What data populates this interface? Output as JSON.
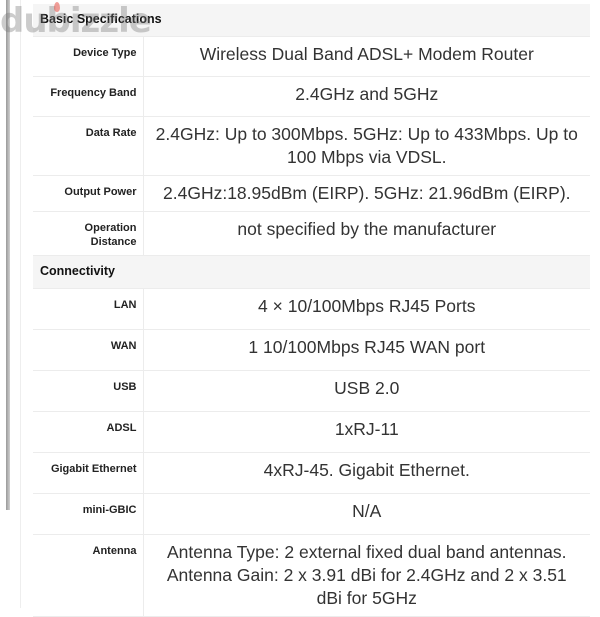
{
  "watermark": {
    "text": "dubizzle"
  },
  "sections": [
    {
      "title": "Basic Specifications",
      "rows": [
        {
          "label": "Device Type",
          "value": "Wireless Dual Band ADSL+ Modem Router"
        },
        {
          "label": "Frequency Band",
          "value": "2.4GHz and 5GHz"
        },
        {
          "label": "Data Rate",
          "value": "2.4GHz: Up to 300Mbps. 5GHz: Up to 433Mbps. Up to 100 Mbps via VDSL."
        },
        {
          "label": "Output Power",
          "value": "2.4GHz:18.95dBm (EIRP). 5GHz: 21.96dBm (EIRP)."
        },
        {
          "label": "Operation Distance",
          "value": "not specified by the manufacturer"
        }
      ]
    },
    {
      "title": "Connectivity",
      "rows": [
        {
          "label": "LAN",
          "value": "4 × 10/100Mbps RJ45 Ports"
        },
        {
          "label": "WAN",
          "value": "1 10/100Mbps RJ45 WAN port"
        },
        {
          "label": "USB",
          "value": "USB 2.0"
        },
        {
          "label": "ADSL",
          "value": "1xRJ-11"
        },
        {
          "label": "Gigabit Ethernet",
          "value": "4xRJ-45. Gigabit Ethernet."
        },
        {
          "label": "mini-GBIC",
          "value": "N/A"
        },
        {
          "label": "Antenna",
          "value": "Antenna Type: 2 external fixed dual band antennas. Antenna Gain: 2 x 3.91 dBi for 2.4GHz and 2 x 3.51 dBi for 5GHz"
        }
      ]
    }
  ]
}
